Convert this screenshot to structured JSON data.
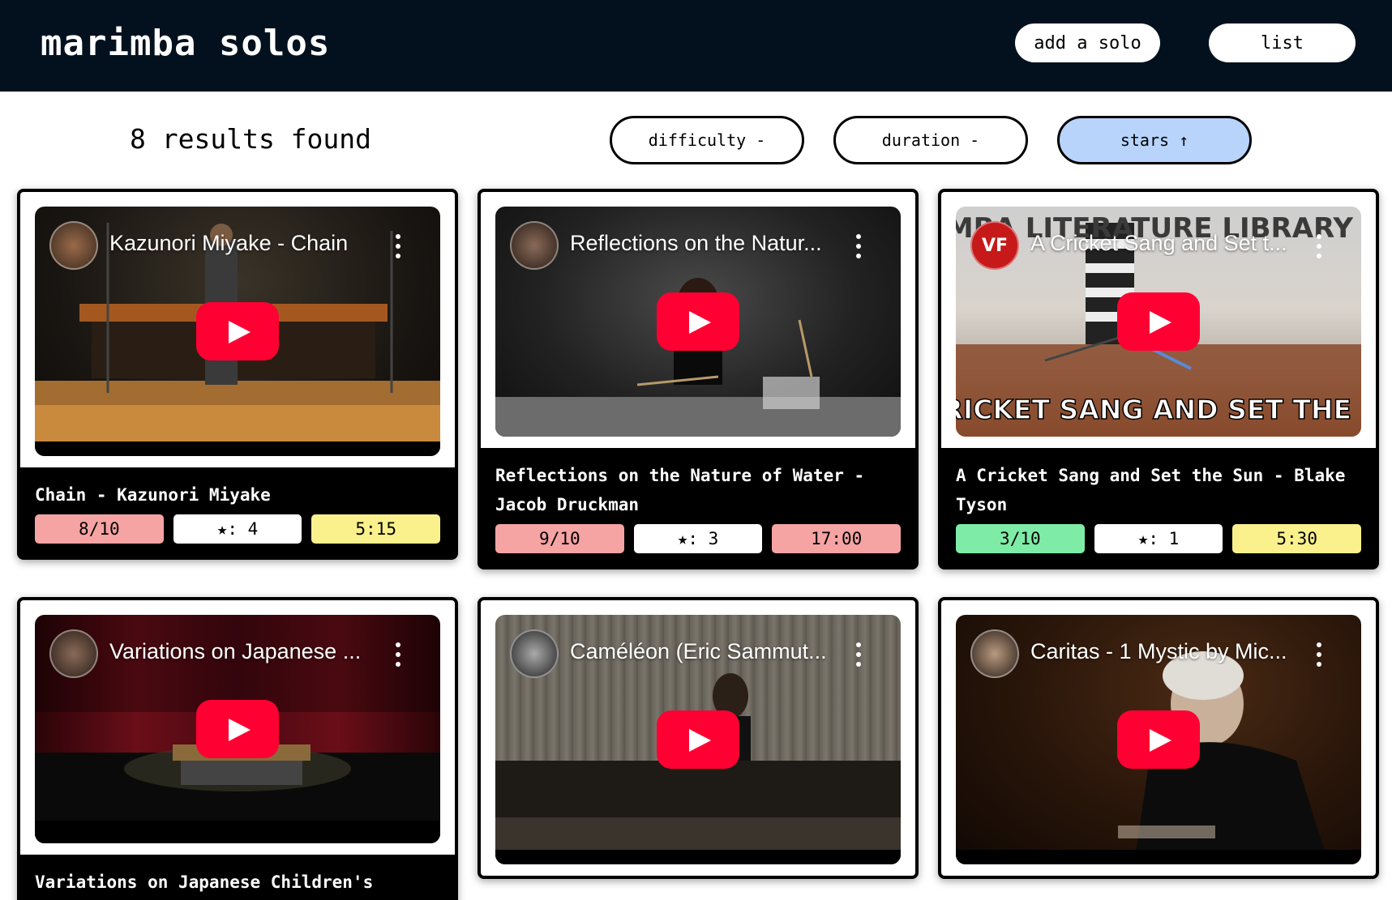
{
  "header": {
    "title": "marimba solos",
    "add_label": "add a solo",
    "list_label": "list"
  },
  "results_text": "8 results found",
  "sort": {
    "difficulty": "difficulty -",
    "duration": "duration -",
    "stars": "stars ↑"
  },
  "cards": [
    {
      "video_title": "Kazunori Miyake - Chain",
      "name": "Chain - Kazunori Miyake",
      "difficulty": "8/10",
      "stars": "★: 4",
      "duration": "5:15"
    },
    {
      "video_title": "Reflections on the Natur...",
      "name": "Reflections on the Nature of Water - Jacob Druckman",
      "difficulty": "9/10",
      "stars": "★: 3",
      "duration": "17:00"
    },
    {
      "video_title": "A Cricket Sang and Set t...",
      "name": "A Cricket Sang and Set the Sun - Blake Tyson",
      "difficulty": "3/10",
      "stars": "★: 1",
      "duration": "5:30",
      "overlay_top": "MARIMBA LITERATURE LIBRARY",
      "overlay_bottom": "A CRICKET SANG AND SET THE SUN",
      "channel_logo": "VF"
    },
    {
      "video_title": "Variations on Japanese ...",
      "name": "Variations on Japanese Children's"
    },
    {
      "video_title": "Caméléon (Eric Sammut..."
    },
    {
      "video_title": "Caritas - 1 Mystic by Mic..."
    }
  ]
}
